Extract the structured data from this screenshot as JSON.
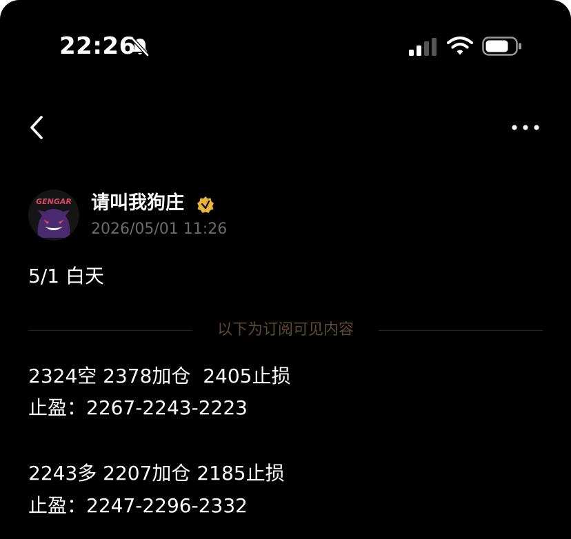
{
  "status_bar": {
    "time": "22:26",
    "icons": [
      "bell-slash-icon",
      "cellular-signal-icon",
      "wifi-icon",
      "battery-icon"
    ]
  },
  "nav": {
    "icons": [
      "chevron-left-icon",
      "more-horizontal-icon"
    ]
  },
  "author": {
    "name": "请叫我狗庄",
    "timestamp": "2026/05/01 11:26",
    "avatar_text": "GENGAR",
    "badge_icon": "verified-badge-icon"
  },
  "post": {
    "headline": "5/1 白天",
    "subscriber_divider": "以下为订阅可见内容",
    "lines": [
      "2324空 2378加仓  2405止损",
      "止盈：2267-2243-2223",
      "2243多 2207加仓 2185止损",
      "止盈：2247-2296-2332"
    ]
  },
  "colors": {
    "background": "#000000",
    "text": "#ffffff",
    "muted": "#6b6b6b",
    "divider_label": "#5e4a2c",
    "badge": "#e8b43c"
  }
}
